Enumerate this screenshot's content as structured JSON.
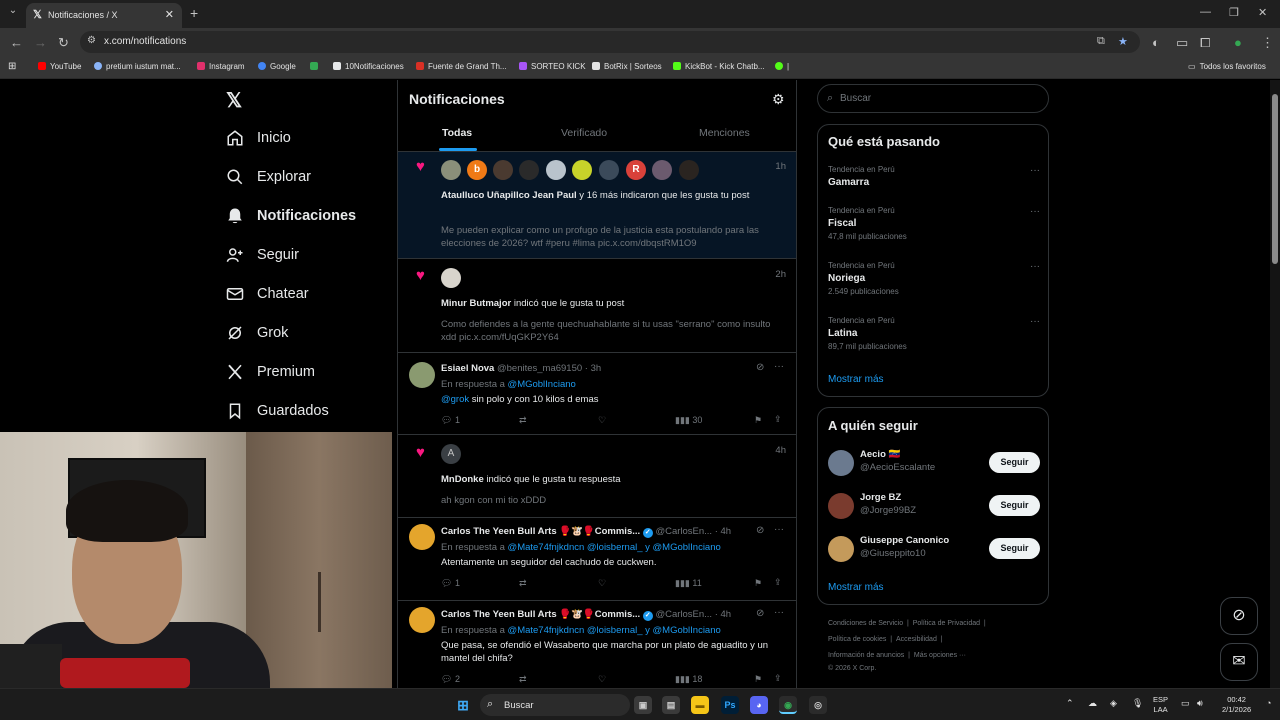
{
  "browser": {
    "tab_title": "Notificaciones / X",
    "url": "x.com/notifications",
    "bookmarks": [
      {
        "label": "YouTube",
        "color": "#ff0000"
      },
      {
        "label": "pretium iustum mat...",
        "color": "#8ab4f8"
      },
      {
        "label": "Instagram",
        "color": "#e1306c"
      },
      {
        "label": "Google",
        "color": "#4285f4"
      },
      {
        "label": "",
        "color": "#34a853"
      },
      {
        "label": "10Notificaciones",
        "color": "#e7e9ea"
      },
      {
        "label": "Fuente de Grand Th...",
        "color": "#d93025"
      },
      {
        "label": "SORTEO KICK",
        "color": "#a855f7"
      },
      {
        "label": "BotRix | Sorteos",
        "color": "#e3e3e3"
      },
      {
        "label": "KickBot - Kick Chatb...",
        "color": "#53fc18"
      },
      {
        "label": "",
        "color": "#53fc18"
      }
    ],
    "all_bookmarks": "Todos los favoritos"
  },
  "sidebar": {
    "items": [
      {
        "label": "Inicio",
        "icon": "home-icon"
      },
      {
        "label": "Explorar",
        "icon": "search-icon"
      },
      {
        "label": "Notificaciones",
        "icon": "bell-icon",
        "active": true
      },
      {
        "label": "Seguir",
        "icon": "person-add-icon"
      },
      {
        "label": "Chatear",
        "icon": "mail-icon"
      },
      {
        "label": "Grok",
        "icon": "grok-icon"
      },
      {
        "label": "Premium",
        "icon": "x-icon"
      },
      {
        "label": "Guardados",
        "icon": "bookmark-icon"
      }
    ]
  },
  "main": {
    "title": "Notificaciones",
    "tabs": [
      "Todas",
      "Verificado",
      "Menciones"
    ],
    "notifications": [
      {
        "type": "like",
        "time": "1h",
        "bold": "Ataulluco Uñapillco Jean Paul",
        "text": " y 16 más indicaron que les gusta tu post",
        "preview": "Me pueden explicar como un profugo de la justicia esta postulando para las elecciones de 2026? wtf #peru #lima pic.x.com/dbqstRM1O9"
      },
      {
        "type": "like",
        "time": "2h",
        "bold": "Minur Butmajor",
        "text": " indicó que le gusta tu post",
        "preview": "Como defiendes a la gente quechuahablante si tu usas \"serrano\" como insulto xdd pic.x.com/fUqGKP2Y64"
      },
      {
        "type": "reply",
        "name": "Esiael Nova",
        "handle": "@benites_ma69150 · 3h",
        "reply_to_label": "En respuesta a",
        "reply_to": "@MGoblInciano",
        "mention": "@grok",
        "body": " sin polo y con 10 kilos d emas",
        "replies": "1",
        "likes": "",
        "views": "30"
      },
      {
        "type": "like",
        "time": "4h",
        "avatar_letter": "A",
        "bold": "MnDonke",
        "text": " indicó que le gusta tu respuesta",
        "preview": "ah kgon con mi tio xDDD"
      },
      {
        "type": "reply",
        "name": "Carlos The Yeen Bull Arts 🥊🐮🥊Commis...",
        "handle": "@CarlosEn... · 4h",
        "reply_to_label": "En respuesta a",
        "reply_to": "@Mate74fnjkdncn @loisbernal_ y @MGoblInciano",
        "body": "Atentamente un seguidor del cachudo de cuckwen.",
        "replies": "1",
        "views": "11"
      },
      {
        "type": "reply",
        "name": "Carlos The Yeen Bull Arts 🥊🐮🥊Commis...",
        "handle": "@CarlosEn... · 4h",
        "reply_to_label": "En respuesta a",
        "reply_to": "@Mate74fnjkdncn @loisbernal_ y @MGoblInciano",
        "body": "Que pasa, se ofendió el Wasaberto que marcha por un plato de aguadito y un mantel del chifa?",
        "replies": "2",
        "views": "18"
      }
    ]
  },
  "right": {
    "search_placeholder": "Buscar",
    "trends_title": "Qué está pasando",
    "trends": [
      {
        "context": "Tendencia en Perú",
        "name": "Gamarra",
        "count": ""
      },
      {
        "context": "Tendencia en Perú",
        "name": "Fiscal",
        "count": "47,8 mil publicaciones"
      },
      {
        "context": "Tendencia en Perú",
        "name": "Noriega",
        "count": "2.549 publicaciones"
      },
      {
        "context": "Tendencia en Perú",
        "name": "Latina",
        "count": "89,7 mil publicaciones"
      }
    ],
    "show_more": "Mostrar más",
    "who_title": "A quién seguir",
    "who": [
      {
        "name": "Aecio 🇻🇪",
        "handle": "@AecioEscalante",
        "color": "#6b7a8f"
      },
      {
        "name": "Jorge BZ",
        "handle": "@Jorge99BZ",
        "color": "#7a3b2e"
      },
      {
        "name": "Giuseppe Canonico",
        "handle": "@Giuseppito10",
        "color": "#c49a5b"
      }
    ],
    "follow_label": "Seguir",
    "footer": {
      "line1": [
        "Condiciones de Servicio",
        "Política de Privacidad"
      ],
      "line2": [
        "Política de cookies",
        "Accesibilidad"
      ],
      "line3": [
        "Información de anuncios",
        "Más opciones ···"
      ],
      "copyright": "© 2026 X Corp."
    }
  },
  "taskbar": {
    "search": "Buscar",
    "lang_top": "ESP",
    "lang_bottom": "LAA",
    "time": "00:42",
    "date": "2/1/2026"
  }
}
